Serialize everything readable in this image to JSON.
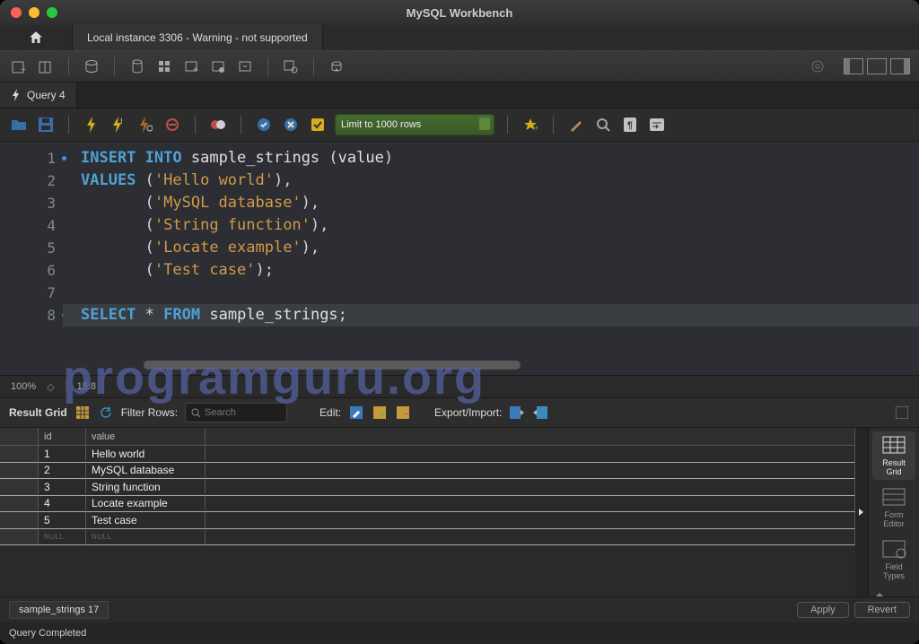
{
  "window": {
    "title": "MySQL Workbench"
  },
  "connection_tab": "Local instance 3306 - Warning - not supported",
  "query_tab": "Query 4",
  "limit_selector": "Limit to 1000 rows",
  "code": {
    "l1": {
      "kw1": "INSERT",
      "kw2": "INTO",
      "ident": "sample_strings",
      "paren": "(",
      "col": "value",
      "paren2": ")"
    },
    "l2": {
      "kw": "VALUES",
      "po": "(",
      "str": "'Hello world'",
      "pc": "),"
    },
    "l3": {
      "po": "(",
      "str": "'MySQL database'",
      "pc": "),"
    },
    "l4": {
      "po": "(",
      "str": "'String function'",
      "pc": "),"
    },
    "l5": {
      "po": "(",
      "str": "'Locate example'",
      "pc": "),"
    },
    "l6": {
      "po": "(",
      "str": "'Test case'",
      "pc": ");"
    },
    "l8": {
      "kw1": "SELECT",
      "star": "*",
      "kw2": "FROM",
      "ident": "sample_strings",
      "semi": ";"
    }
  },
  "zoom": {
    "percent": "100%",
    "pos": "15:8"
  },
  "resultbar": {
    "label": "Result Grid",
    "filter_label": "Filter Rows:",
    "filter_placeholder": "Search",
    "edit_label": "Edit:",
    "export_label": "Export/Import:"
  },
  "columns": {
    "c1": "id",
    "c2": "value"
  },
  "rows": [
    {
      "id": "1",
      "value": "Hello world"
    },
    {
      "id": "2",
      "value": "MySQL database"
    },
    {
      "id": "3",
      "value": "String function"
    },
    {
      "id": "4",
      "value": "Locate example"
    },
    {
      "id": "5",
      "value": "Test case"
    }
  ],
  "null_label": "NULL",
  "side": {
    "result_grid": "Result\nGrid",
    "form_editor": "Form\nEditor",
    "field_types": "Field\nTypes"
  },
  "result_tab_label": "sample_strings 17",
  "apply": "Apply",
  "revert": "Revert",
  "status": "Query Completed",
  "watermark": "programguru.org"
}
